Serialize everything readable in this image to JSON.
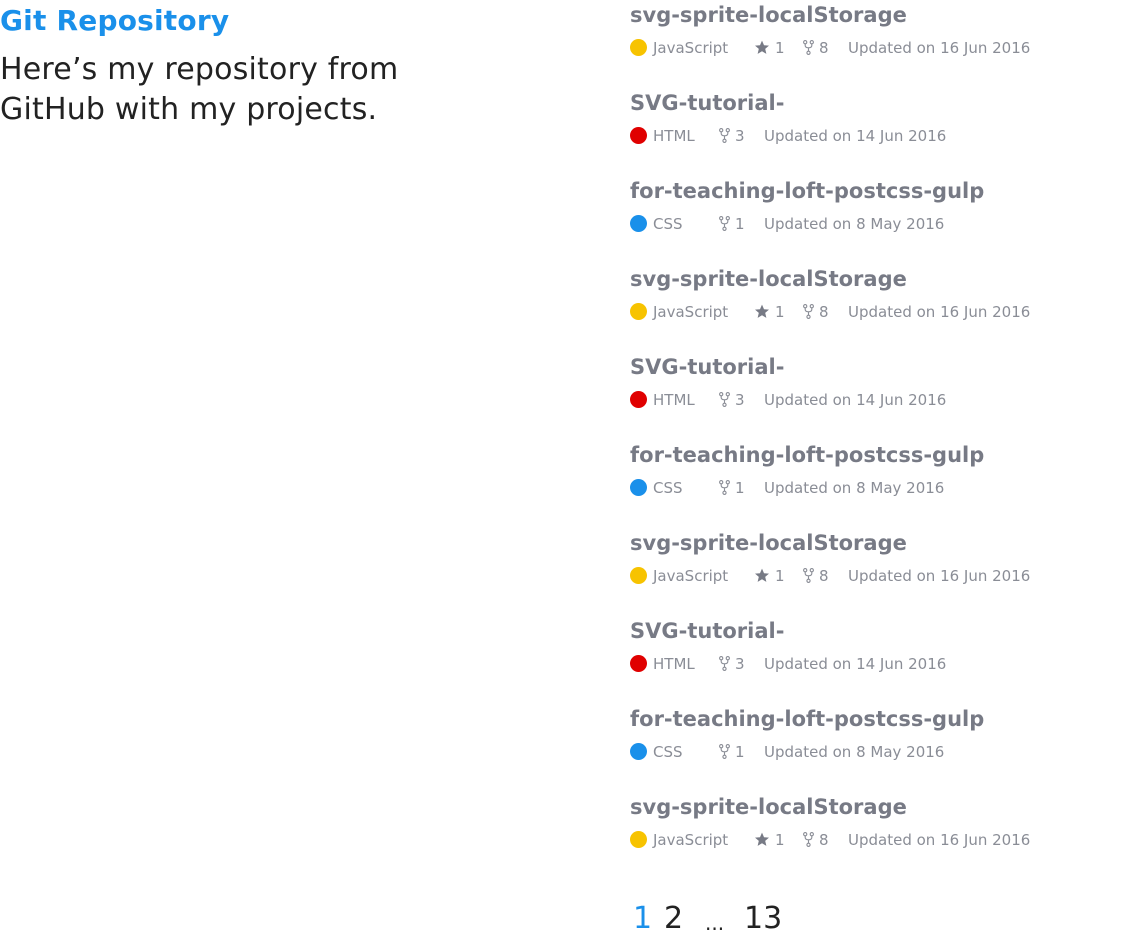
{
  "intro": {
    "title": "Git Repository",
    "text": "Here’s my repository from GitHub with my projects."
  },
  "language_colors": {
    "JavaScript": "#f7c300",
    "HTML": "#e00000",
    "CSS": "#1a90ea"
  },
  "icons": {
    "star": "star-icon",
    "fork": "fork-icon"
  },
  "repositories": [
    {
      "name": "svg-sprite-localStorage",
      "language": "JavaScript",
      "stars": "1",
      "forks": "8",
      "updated": "Updated on 16 Jun 2016"
    },
    {
      "name": "SVG-tutorial-",
      "language": "HTML",
      "stars": null,
      "forks": "3",
      "updated": "Updated on 14 Jun 2016"
    },
    {
      "name": "for-teaching-loft-postcss-gulp",
      "language": "CSS",
      "stars": null,
      "forks": "1",
      "updated": "Updated on 8 May 2016"
    },
    {
      "name": "svg-sprite-localStorage",
      "language": "JavaScript",
      "stars": "1",
      "forks": "8",
      "updated": "Updated on 16 Jun 2016"
    },
    {
      "name": "SVG-tutorial-",
      "language": "HTML",
      "stars": null,
      "forks": "3",
      "updated": "Updated on 14 Jun 2016"
    },
    {
      "name": "for-teaching-loft-postcss-gulp",
      "language": "CSS",
      "stars": null,
      "forks": "1",
      "updated": "Updated on 8 May 2016"
    },
    {
      "name": "svg-sprite-localStorage",
      "language": "JavaScript",
      "stars": "1",
      "forks": "8",
      "updated": "Updated on 16 Jun 2016"
    },
    {
      "name": "SVG-tutorial-",
      "language": "HTML",
      "stars": null,
      "forks": "3",
      "updated": "Updated on 14 Jun 2016"
    },
    {
      "name": "for-teaching-loft-postcss-gulp",
      "language": "CSS",
      "stars": null,
      "forks": "1",
      "updated": "Updated on 8 May 2016"
    },
    {
      "name": "svg-sprite-localStorage",
      "language": "JavaScript",
      "stars": "1",
      "forks": "8",
      "updated": "Updated on 16 Jun 2016"
    }
  ],
  "pagination": {
    "pages": [
      "1",
      "2",
      "13"
    ],
    "current": "1",
    "ellipsis": "..."
  }
}
